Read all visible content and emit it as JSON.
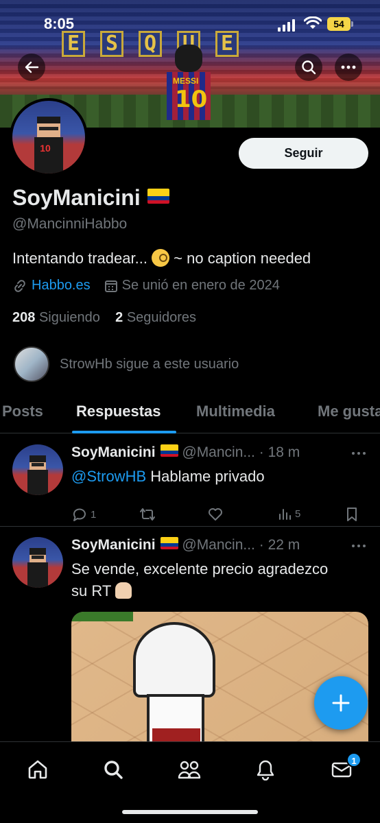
{
  "status_bar": {
    "time": "8:05",
    "battery": "54"
  },
  "profile": {
    "display_name": "SoyManicini",
    "handle": "@MancinniHabbo",
    "bio_before": "Intentando tradear... ",
    "bio_after": " ~ no caption needed",
    "link": "Habbo.es",
    "joined": "Se unió en enero de 2024",
    "following_count": "208",
    "following_label": "Siguiendo",
    "followers_count": "2",
    "followers_label": "Seguidores",
    "follow_button": "Seguir",
    "followed_by": "StrowHb sigue a este usuario",
    "flag_colors": [
      "#FCD116",
      "#003893",
      "#CE1126"
    ]
  },
  "tabs": [
    "Posts",
    "Respuestas",
    "Multimedia",
    "Me gusta"
  ],
  "active_tab": "Respuestas",
  "posts": [
    {
      "author": "SoyManicini",
      "handle": "@Mancin...",
      "time": "18 m",
      "mention": "@StrowHB",
      "text": " Hablame privado",
      "replies": "1",
      "views": "5"
    },
    {
      "author": "SoyManicini",
      "handle": "@Mancin...",
      "time": "22 m",
      "text_line1": "Se vende, excelente precio agradezco",
      "text_line2": "su RT "
    }
  ],
  "banner": {
    "letters": [
      "E",
      "S",
      "Q",
      "U",
      "E"
    ],
    "shirt_name": "MESSI",
    "shirt_number": "10"
  },
  "notifications_badge": "1",
  "colors": {
    "accent": "#1d9bf0",
    "background": "#000000",
    "muted": "#71767b"
  }
}
